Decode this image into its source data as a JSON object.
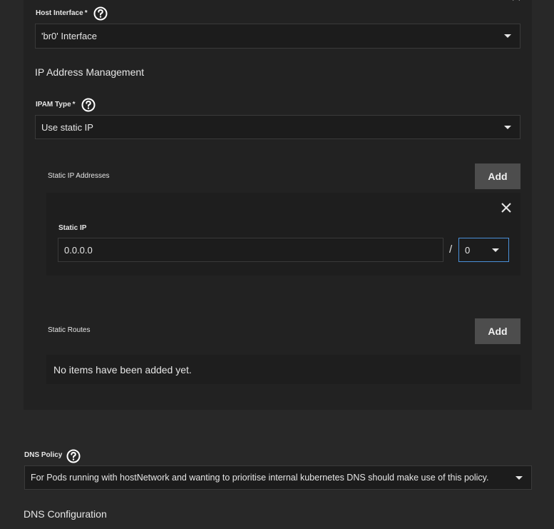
{
  "host_interface": {
    "label": "Host Interface",
    "required_mark": "*",
    "value": "'br0' Interface"
  },
  "ipam": {
    "section_title": "IP Address Management",
    "type_label": "IPAM Type",
    "required_mark": "*",
    "type_value": "Use static IP"
  },
  "static_ips": {
    "title": "Static IP Addresses",
    "add_label": "Add",
    "item": {
      "ip_label": "Static IP",
      "ip_value": "0.0.0.0",
      "separator": "/",
      "prefix_value": "0"
    }
  },
  "static_routes": {
    "title": "Static Routes",
    "add_label": "Add",
    "empty_text": "No items have been added yet."
  },
  "dns_policy": {
    "label": "DNS Policy",
    "value": "For Pods running with hostNetwork and wanting to prioritise internal kubernetes DNS should make use of this policy."
  },
  "dns_config": {
    "title": "DNS Configuration"
  },
  "icons": {
    "help": "help-circle-icon",
    "close": "close-icon",
    "dropdown": "caret-down-icon"
  }
}
